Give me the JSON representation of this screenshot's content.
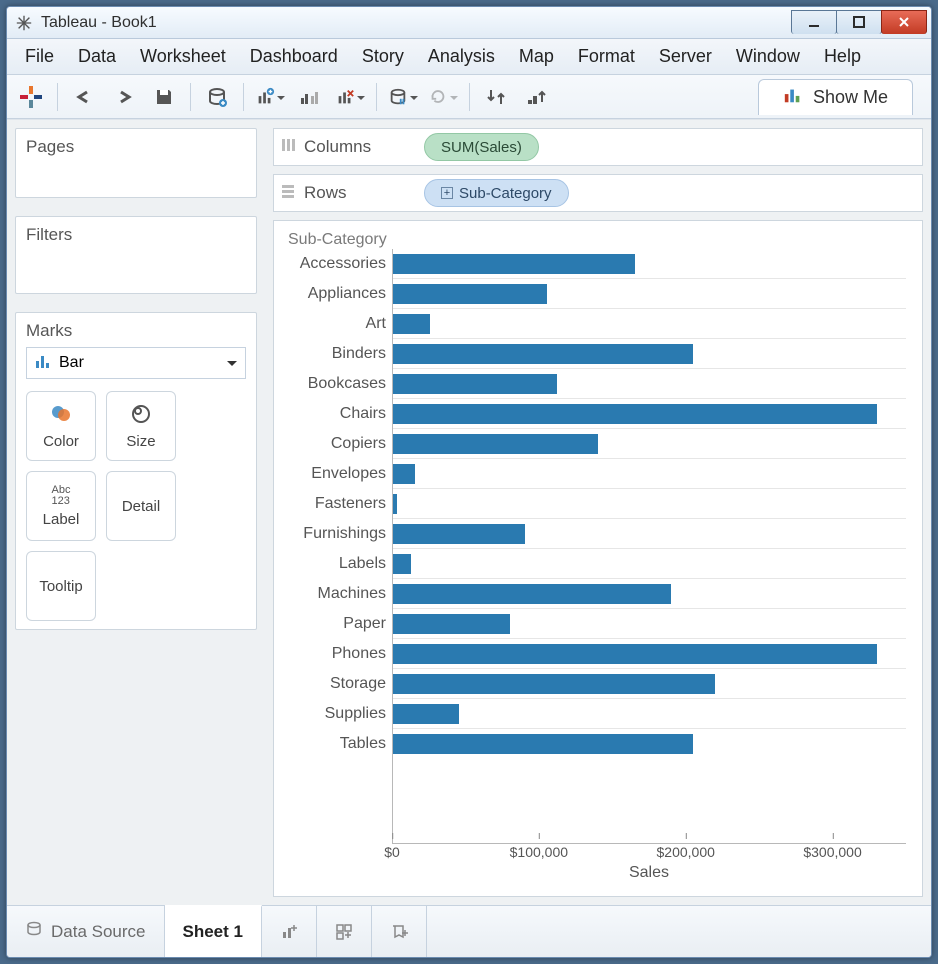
{
  "window": {
    "title": "Tableau - Book1"
  },
  "menu": [
    "File",
    "Data",
    "Worksheet",
    "Dashboard",
    "Story",
    "Analysis",
    "Map",
    "Format",
    "Server",
    "Window",
    "Help"
  ],
  "toolbar": {
    "show_me": "Show Me"
  },
  "left": {
    "pages": "Pages",
    "filters": "Filters",
    "marks": "Marks",
    "mark_type": "Bar",
    "cells": {
      "color": "Color",
      "size": "Size",
      "label": "Label",
      "detail": "Detail",
      "tooltip": "Tooltip"
    }
  },
  "shelves": {
    "columns_label": "Columns",
    "rows_label": "Rows",
    "columns_pill": "SUM(Sales)",
    "rows_pill": "Sub-Category"
  },
  "viz": {
    "header": "Sub-Category",
    "x_title": "Sales",
    "x_ticks": [
      "$0",
      "$100,000",
      "$200,000",
      "$300,000"
    ]
  },
  "bottom": {
    "data_source": "Data Source",
    "sheet": "Sheet 1"
  },
  "chart_data": {
    "type": "bar",
    "orientation": "horizontal",
    "title": "",
    "xlabel": "Sales",
    "ylabel": "Sub-Category",
    "xlim": [
      0,
      350000
    ],
    "x_ticks": [
      0,
      100000,
      200000,
      300000
    ],
    "x_tick_labels": [
      "$0",
      "$100,000",
      "$200,000",
      "$300,000"
    ],
    "categories": [
      "Accessories",
      "Appliances",
      "Art",
      "Binders",
      "Bookcases",
      "Chairs",
      "Copiers",
      "Envelopes",
      "Fasteners",
      "Furnishings",
      "Labels",
      "Machines",
      "Paper",
      "Phones",
      "Storage",
      "Supplies",
      "Tables"
    ],
    "values": [
      165000,
      105000,
      25000,
      205000,
      112000,
      330000,
      140000,
      15000,
      3000,
      90000,
      12000,
      190000,
      80000,
      330000,
      220000,
      45000,
      205000
    ]
  }
}
